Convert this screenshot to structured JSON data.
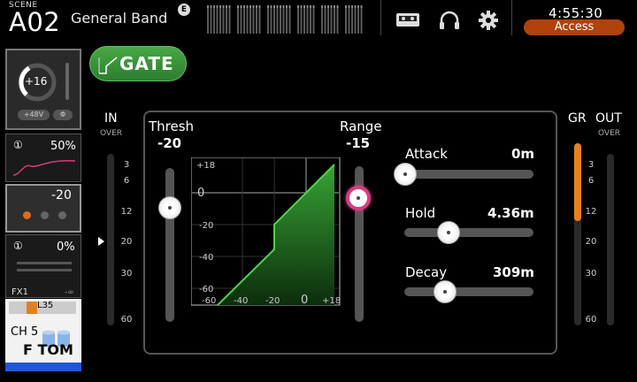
{
  "header": {
    "scene_label": "SCENE",
    "scene_number": "A02",
    "scene_name": "General Band",
    "edit_badge": "E",
    "time": "4:55:30",
    "access_label": "Access",
    "icons": [
      "recorder-icon",
      "headphones-icon",
      "gear-icon"
    ]
  },
  "strip": {
    "gain_value": "+16",
    "phantom_label": "+48V",
    "phase_symbol": "Φ",
    "eq_value": "50%",
    "dyn_threshold": "-20",
    "send_value": "0%",
    "fx_label": "FX1",
    "fx_level": "-∞",
    "pan_label": "L35",
    "channel_id": "CH 5",
    "channel_name": "F TOM",
    "power_symbol": "①"
  },
  "gate": {
    "button_label": "GATE",
    "in_label": "IN",
    "in_over": "OVER",
    "gr_label": "GR",
    "out_label": "OUT",
    "out_over": "OVER",
    "meter_scale": [
      "3",
      "6",
      "12",
      "20",
      "30",
      "60"
    ],
    "threshold": {
      "label": "Thresh",
      "value": "-20",
      "level_fraction": 0.65
    },
    "range": {
      "label": "Range",
      "value": "-15",
      "level_fraction": 0.79
    },
    "attack": {
      "label": "Attack",
      "value": "0m",
      "fraction": 0.0
    },
    "hold": {
      "label": "Hold",
      "value": "4.36m",
      "fraction": 0.33
    },
    "decay": {
      "label": "Decay",
      "value": "309m",
      "fraction": 0.31
    },
    "graph": {
      "y_ticks": [
        "+18",
        "0",
        "-20",
        "-40",
        "-60"
      ],
      "x_ticks": [
        "-60",
        "-40",
        "-20",
        "0",
        "+18"
      ]
    },
    "colors": {
      "accent_green": "#3ca23a",
      "range_knob": "#d63d82",
      "gr_meter": "#e8801f",
      "access_bg": "#b0420c"
    }
  }
}
